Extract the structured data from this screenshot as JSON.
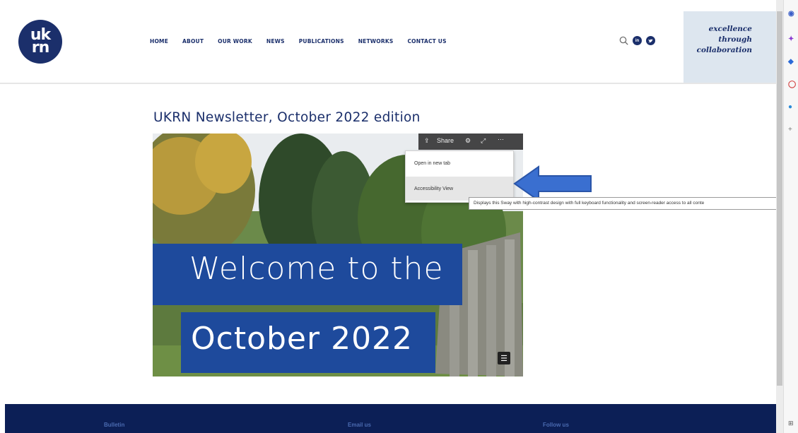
{
  "logo": {
    "text": "uk\nrn"
  },
  "nav": [
    "HOME",
    "ABOUT",
    "OUR WORK",
    "NEWS",
    "PUBLICATIONS",
    "NETWORKS",
    "CONTACT US"
  ],
  "tagline": [
    "excellence",
    "through",
    "collaboration"
  ],
  "header_icons": [
    "search-icon",
    "linkedin-icon",
    "twitter-icon"
  ],
  "page": {
    "title": "UKRN Newsletter, October 2022 edition"
  },
  "sway": {
    "line1": "Welcome to the",
    "line2": "October 2022",
    "toolbar": {
      "share_label": "Share"
    },
    "menu": {
      "open_new_tab": "Open in new tab",
      "accessibility_view": "Accessibility View"
    },
    "tooltip": "Displays this Sway with high-contrast design with full keyboard functionality and screen-reader access to all conte"
  },
  "annotation": {
    "arrow_color": "#3a6fd0"
  },
  "footer": {
    "col1": "Bulletin",
    "col2": "Email us",
    "col3": "Follow us"
  },
  "colors": {
    "brand_navy": "#1b2f6b",
    "band_blue": "#1e4a9c",
    "footer": "#0c1f56"
  }
}
